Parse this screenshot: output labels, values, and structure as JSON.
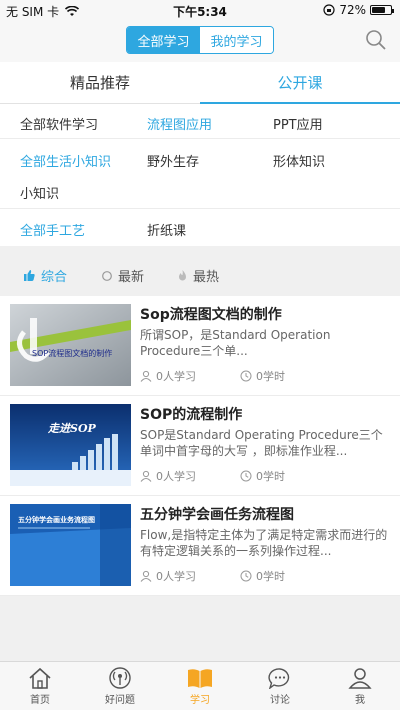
{
  "status": {
    "carrier": "无 SIM 卡",
    "time": "下午5:34",
    "battery_text": "72%",
    "battery_level": 0.72
  },
  "header": {
    "segments": [
      "全部学习",
      "我的学习"
    ],
    "active_segment": 0
  },
  "tabs": [
    "精品推荐",
    "公开课"
  ],
  "categories": {
    "row1": [
      "全部软件学习",
      "流程图应用",
      "PPT应用"
    ],
    "row2": [
      "全部生活小知识",
      "野外生存",
      "形体知识",
      "小知识"
    ],
    "row3": [
      "全部手工艺",
      "折纸课"
    ]
  },
  "sort": [
    "综合",
    "最新",
    "最热"
  ],
  "courses": [
    {
      "title": "Sop流程图文档的制作",
      "desc": "所谓SOP，是Standard Operation Procedure三个单...",
      "thumb_caption": "SOP流程图文档的制作",
      "learners": "0人学习",
      "hours": "0学时"
    },
    {
      "title": "SOP的流程制作",
      "desc": "SOP是Standard Operating Procedure三个单词中首字母的大写 ，即标准作业程...",
      "thumb_caption": "走进SOP",
      "learners": "0人学习",
      "hours": "0学时"
    },
    {
      "title": "五分钟学会画任务流程图",
      "desc": "Flow,是指特定主体为了满足特定需求而进行的有特定逻辑关系的一系列操作过程...",
      "thumb_caption": "五分钟学会画业务流程图",
      "learners": "0人学习",
      "hours": "0学时"
    }
  ],
  "tabbar": [
    "首页",
    "好问题",
    "学习",
    "讨论",
    "我"
  ],
  "colors": {
    "accent": "#2ea7e0",
    "tab_active": "#f5a623"
  }
}
